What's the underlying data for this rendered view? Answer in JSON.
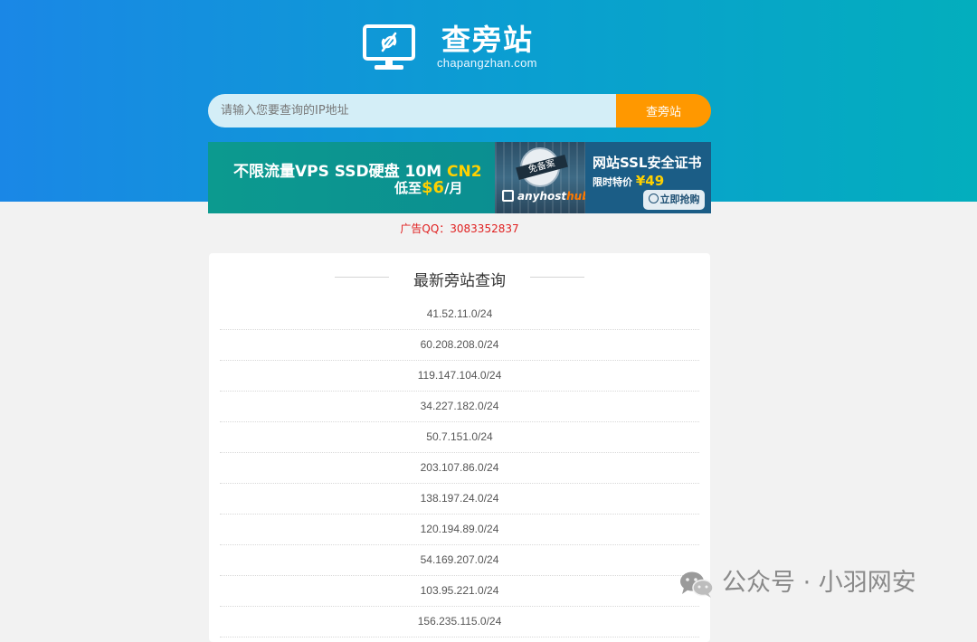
{
  "header": {
    "logo_icon": "monitor-link-icon",
    "site_title": "查旁站",
    "site_domain": "chapangzhan.com"
  },
  "search": {
    "placeholder": "请输入您要查询的IP地址",
    "value": "",
    "button_label": "查旁站"
  },
  "ad_banner": {
    "headline_plain": "不限流量VPS SSD硬盘 10M ",
    "headline_highlight": "CN2",
    "price_prefix": "低至",
    "price_value": "$6",
    "price_suffix": "/月",
    "seal_text": "免备案",
    "brand_plain": "anyhost",
    "brand_highlight": "hub",
    "ssl_title": "网站SSL安全证书",
    "ssl_price_label": "限时特价",
    "ssl_price_value": "¥49",
    "buy_label": "立即抢购"
  },
  "ad_contact": "广告QQ：3083352837",
  "latest": {
    "title": "最新旁站查询",
    "items": [
      "41.52.11.0/24",
      "60.208.208.0/24",
      "119.147.104.0/24",
      "34.227.182.0/24",
      "50.7.151.0/24",
      "203.107.86.0/24",
      "138.197.24.0/24",
      "120.194.89.0/24",
      "54.169.207.0/24",
      "103.95.221.0/24",
      "156.235.115.0/24"
    ]
  },
  "watermark": {
    "icon": "wechat-icon",
    "text": "公众号 · 小羽网安"
  }
}
